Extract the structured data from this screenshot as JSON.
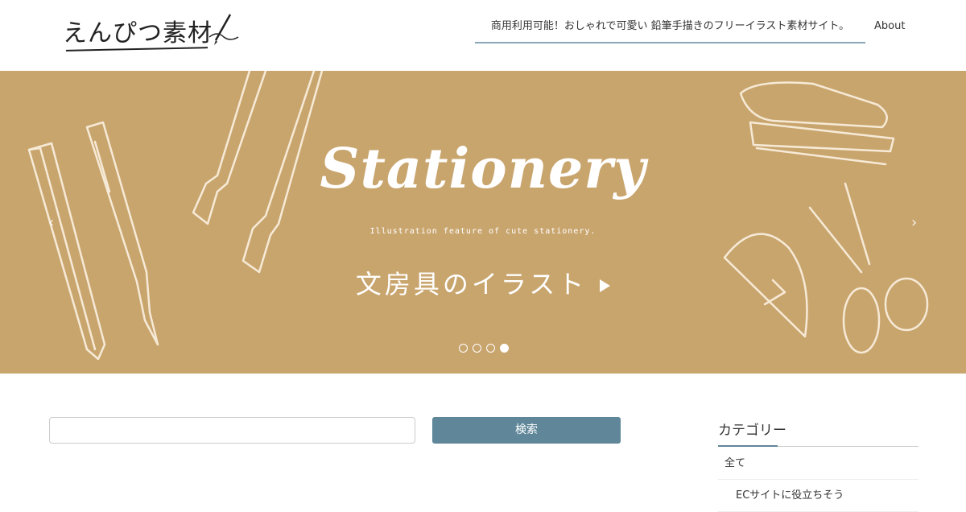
{
  "header": {
    "logo_text": "えんぴつ素材",
    "tagline": "商用利用可能！おしゃれで可愛い 鉛筆手描きのフリーイラスト素材サイト。",
    "nav_about": "About"
  },
  "hero": {
    "title": "Stationery",
    "subtitle": "Illustration feature of cute stationery.",
    "cta": "文房具のイラスト",
    "prev_arrow": "‹",
    "next_arrow": "›",
    "slide_count": 4,
    "active_slide": 4
  },
  "search": {
    "placeholder": "",
    "button_label": "検索"
  },
  "sidebar": {
    "heading": "カテゴリー",
    "items": [
      "全て",
      "ECサイトに役立ちそう"
    ]
  },
  "colors": {
    "hero_bg": "#c9a56e",
    "accent": "#5f8799",
    "tagline_underline": "#8aa5b5"
  }
}
